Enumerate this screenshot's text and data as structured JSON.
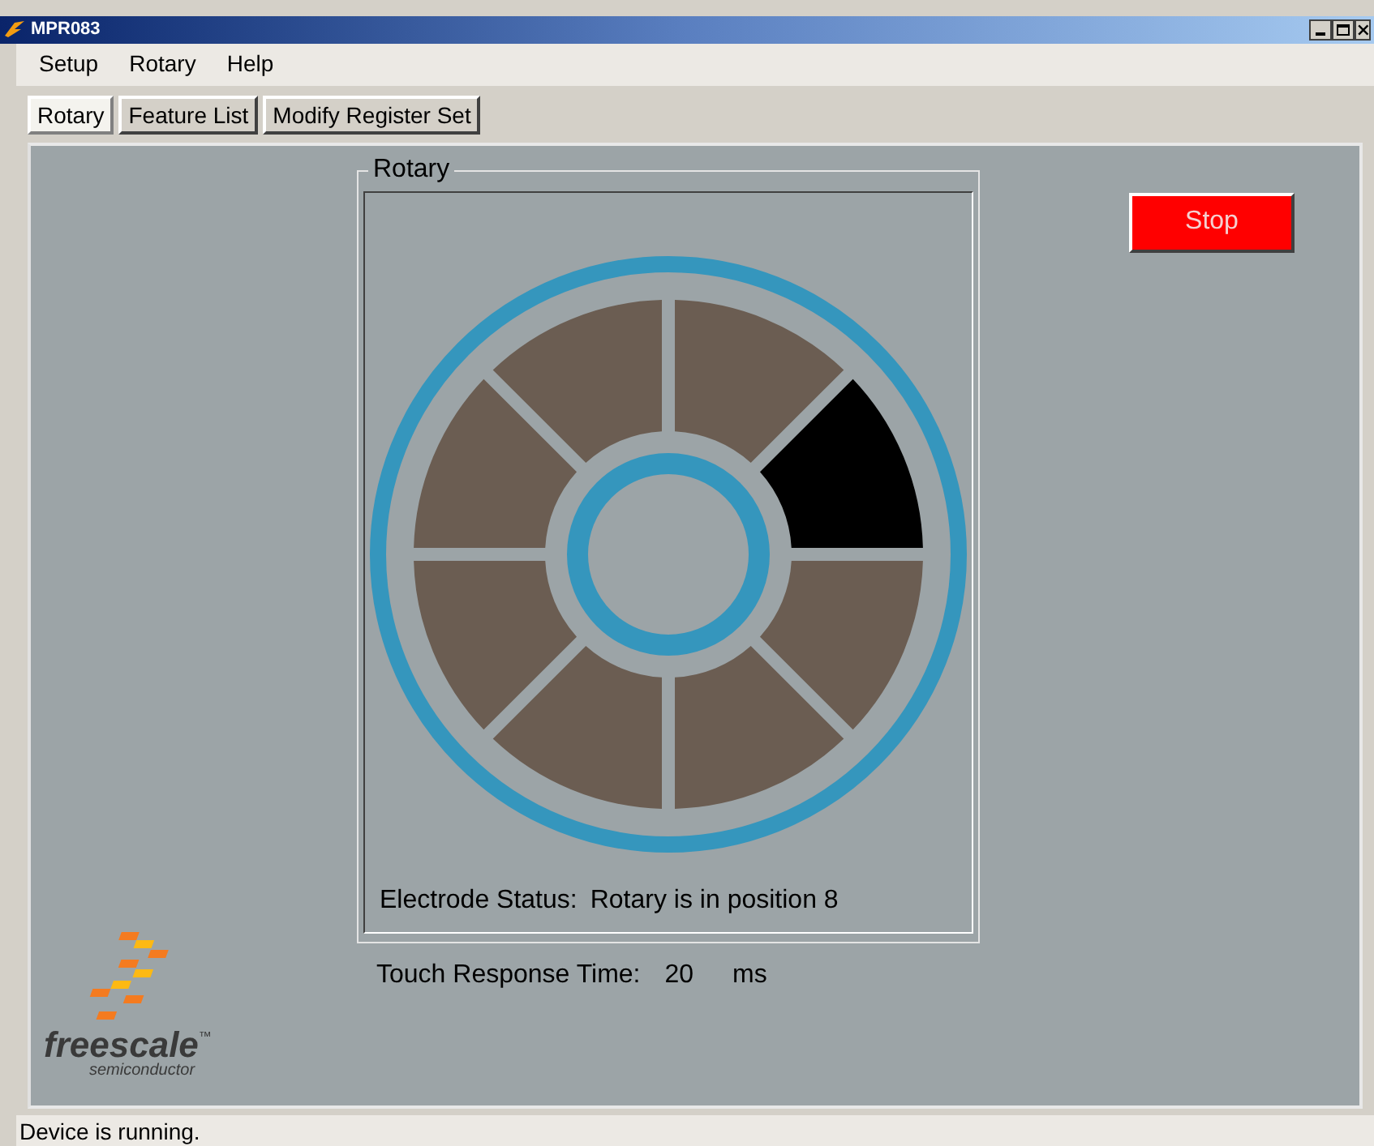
{
  "window": {
    "title": "MPR083"
  },
  "menu": [
    "Setup",
    "Rotary",
    "Help"
  ],
  "tabs": [
    {
      "label": "Rotary",
      "selected": true
    },
    {
      "label": "Feature List",
      "selected": false
    },
    {
      "label": "Modify Register Set",
      "selected": false
    }
  ],
  "rotary_group": {
    "title": "Rotary",
    "segments": [
      {
        "active": false
      },
      {
        "active": true
      },
      {
        "active": false
      },
      {
        "active": false
      },
      {
        "active": false
      },
      {
        "active": false
      },
      {
        "active": false
      },
      {
        "active": false
      }
    ],
    "status_label": "Electrode Status:",
    "status_value": "Rotary is in position 8"
  },
  "touch_response": {
    "label": "Touch Response Time:",
    "value": "20",
    "unit": "ms"
  },
  "stop_button": "Stop",
  "logo": {
    "name": "freescale",
    "tm": "™",
    "tagline": "semiconductor"
  },
  "status_bar": "Device is running."
}
